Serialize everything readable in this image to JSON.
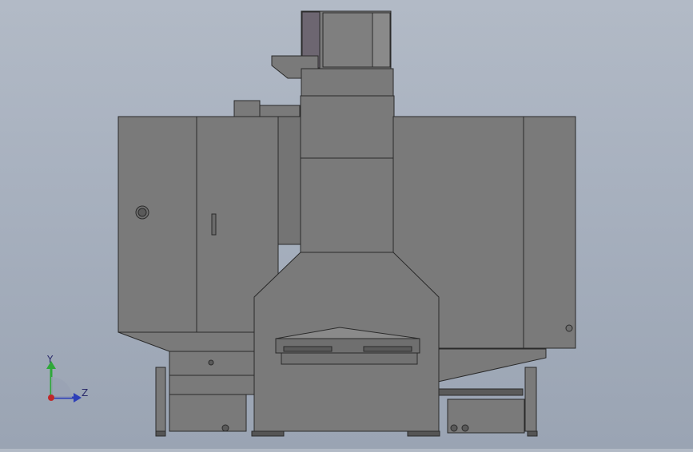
{
  "viewport": {
    "background_top": "#b2bac6",
    "background_bottom": "#9aa4b3",
    "model_fill": "#7a7a7a",
    "model_fill_light": "#868686",
    "edge_color": "#2a2a2a",
    "top_window_color": "#6d6671"
  },
  "triad": {
    "y_label": "Y",
    "z_label": "Z",
    "y_color": "#2fa83a",
    "z_color": "#2d3fb8",
    "x_color": "#c0282a"
  }
}
